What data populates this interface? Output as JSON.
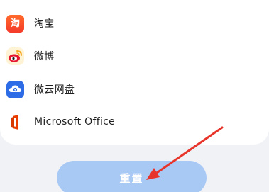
{
  "apps": [
    {
      "label": "淘宝",
      "icon": "taobao-icon",
      "icon_glyph": "淘",
      "color": "#f53a2a"
    },
    {
      "label": "微博",
      "icon": "weibo-icon",
      "color": "#e6162d"
    },
    {
      "label": "微云网盘",
      "icon": "weiyun-icon",
      "color": "#2e6be6"
    },
    {
      "label": "Microsoft Office",
      "icon": "office-icon",
      "color": "#eb3c00"
    }
  ],
  "reset_button": {
    "label": "重置",
    "color": "#a9c9f5"
  },
  "annotation": {
    "arrow_color": "#e8352b"
  }
}
